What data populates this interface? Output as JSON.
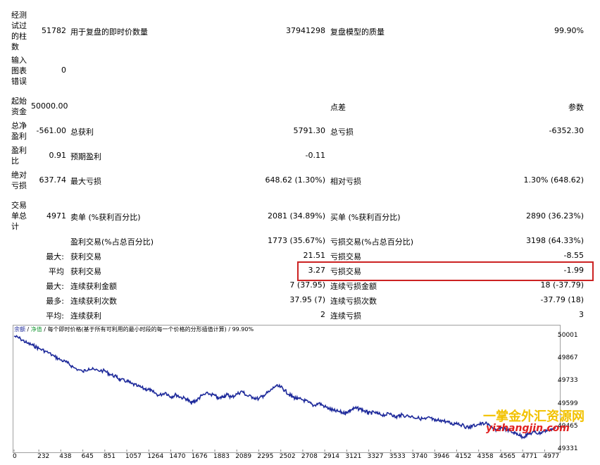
{
  "report": {
    "r1": {
      "label": "经测试过的柱数",
      "value": "51782",
      "mid_label": "用于复盘的即时价数量",
      "mid_value": "37941298",
      "right_label": "复盘模型的质量",
      "right_value": "99.90%"
    },
    "r2": {
      "label": "输入图表错误",
      "value": "0"
    },
    "r3": {
      "label": "起始资金",
      "value": "50000.00",
      "right_label": "点差",
      "right_value": "参数"
    },
    "r4": {
      "label": "总净盈利",
      "value": "-561.00",
      "mid_label": "总获利",
      "mid_value": "5791.30",
      "right_label": "总亏损",
      "right_value": "-6352.30"
    },
    "r5": {
      "label": "盈利比",
      "value": "0.91",
      "mid_label": "预期盈利",
      "mid_value": "-0.11"
    },
    "r6": {
      "label": "绝对亏损",
      "value": "637.74",
      "mid_label": "最大亏损",
      "mid_value": "648.62 (1.30%)",
      "right_label": "相对亏损",
      "right_value": "1.30% (648.62)"
    },
    "r7": {
      "label": "交易单总计",
      "value": "4971",
      "mid_label": "卖单 (%获利百分比)",
      "mid_value": "2081 (34.89%)",
      "right_label": "买单 (%获利百分比)",
      "right_value": "2890 (36.23%)"
    },
    "r8": {
      "mid_label": "盈利交易(%占总百分比)",
      "mid_value": "1773 (35.67%)",
      "right_label": "亏损交易(%占总百分比)",
      "right_value": "3198 (64.33%)"
    },
    "r9": {
      "prefix": "最大:",
      "mid_label": "获利交易",
      "mid_value": "21.51",
      "right_label": "亏损交易",
      "right_value": "-8.55"
    },
    "r10": {
      "prefix": "平均",
      "mid_label": "获利交易",
      "mid_value": "3.27",
      "right_label": "亏损交易",
      "right_value": "-1.99"
    },
    "r11": {
      "prefix": "最大:",
      "mid_label": "连续获利金额",
      "mid_value": "7 (37.95)",
      "right_label": "连续亏损金额",
      "right_value": "18 (-37.79)"
    },
    "r12": {
      "prefix": "最多:",
      "mid_label": "连续获利次数",
      "mid_value": "37.95 (7)",
      "right_label": "连续亏损次数",
      "right_value": "-37.79 (18)"
    },
    "r13": {
      "prefix": "平均:",
      "mid_label": "连续获利",
      "mid_value": "2",
      "right_label": "连续亏损",
      "right_value": "3"
    }
  },
  "legend": {
    "balance": "余额",
    "sep1": " / ",
    "equity": "净值",
    "rest": " / 每个即时价格(基于所有可利用的最小时段的每一个价格的分形插值计算) / 99.90%"
  },
  "watermark": {
    "line1": "一掌金外汇资源网",
    "line2": "yizhangjin.com"
  },
  "colors": {
    "line": "#1e2a9b",
    "highlight": "#cc2222",
    "balance": "#1e2a9b",
    "equity": "#1f9b3b"
  },
  "chart_data": {
    "type": "line",
    "title": "",
    "xlabel": "",
    "ylabel": "",
    "x_ticks": [
      "0",
      "232",
      "438",
      "645",
      "851",
      "1057",
      "1264",
      "1470",
      "1676",
      "1883",
      "2089",
      "2295",
      "2502",
      "2708",
      "2914",
      "3121",
      "3327",
      "3533",
      "3740",
      "3946",
      "4152",
      "4358",
      "4565",
      "4771",
      "4977"
    ],
    "y_ticks": [
      "50001",
      "49867",
      "49733",
      "49599",
      "49465",
      "49331"
    ],
    "xlim": [
      0,
      5100
    ],
    "ylim": [
      49331,
      50001
    ],
    "grid": false,
    "series": [
      {
        "x": [
          0,
          60,
          120,
          180,
          232,
          300,
          380,
          438,
          500,
          560,
          645,
          700,
          760,
          851,
          900,
          960,
          1000,
          1057,
          1100,
          1160,
          1220,
          1264,
          1300,
          1360,
          1420,
          1470,
          1520,
          1560,
          1620,
          1660,
          1676,
          1720,
          1760,
          1820,
          1883,
          1920,
          1960,
          2000,
          2040,
          2089,
          2140,
          2180,
          2240,
          2295,
          2340,
          2400,
          2450,
          2502,
          2540,
          2580,
          2620,
          2660,
          2708,
          2760,
          2810,
          2860,
          2914,
          2960,
          3000,
          3050,
          3100,
          3121,
          3160,
          3200,
          3250,
          3300,
          3327,
          3380,
          3420,
          3480,
          3533,
          3580,
          3620,
          3680,
          3740,
          3800,
          3860,
          3900,
          3946,
          4000,
          4060,
          4110,
          4152,
          4200,
          4260,
          4300,
          4358,
          4420,
          4480,
          4520,
          4565,
          4620,
          4680,
          4720,
          4771,
          4820,
          4880,
          4920,
          4977,
          5030,
          5080
        ],
        "y": [
          50001,
          49985,
          49960,
          49945,
          49928,
          49910,
          49880,
          49860,
          49843,
          49815,
          49790,
          49810,
          49800,
          49795,
          49775,
          49760,
          49742,
          49735,
          49720,
          49705,
          49690,
          49685,
          49672,
          49650,
          49668,
          49642,
          49655,
          49640,
          49630,
          49605,
          49612,
          49625,
          49650,
          49662,
          49650,
          49630,
          49645,
          49655,
          49640,
          49658,
          49675,
          49650,
          49640,
          49630,
          49650,
          49675,
          49705,
          49700,
          49680,
          49655,
          49640,
          49630,
          49625,
          49610,
          49590,
          49605,
          49585,
          49570,
          49560,
          49555,
          49545,
          49552,
          49565,
          49575,
          49570,
          49555,
          49545,
          49550,
          49540,
          49535,
          49545,
          49520,
          49535,
          49530,
          49525,
          49515,
          49510,
          49520,
          49500,
          49505,
          49495,
          49480,
          49490,
          49475,
          49460,
          49470,
          49480,
          49485,
          49465,
          49440,
          49460,
          49450,
          49430,
          49425,
          49405,
          49420,
          49435,
          49425,
          49440,
          49450,
          49455
        ]
      }
    ]
  }
}
